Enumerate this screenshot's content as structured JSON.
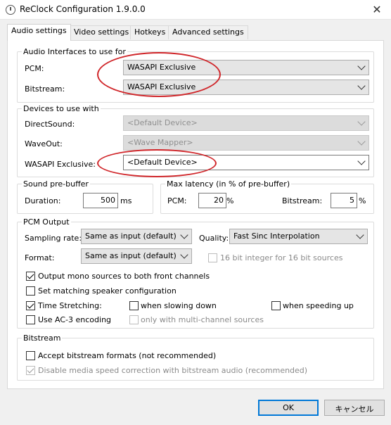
{
  "window": {
    "title": "ReClock Configuration 1.9.0.0"
  },
  "tabs": [
    "Audio settings",
    "Video settings",
    "Hotkeys",
    "Advanced settings"
  ],
  "audio_interfaces": {
    "legend": "Audio Interfaces to use for",
    "pcm_label": "PCM:",
    "pcm_value": "WASAPI Exclusive",
    "bitstream_label": "Bitstream:",
    "bitstream_value": "WASAPI Exclusive"
  },
  "devices": {
    "legend": "Devices to use with",
    "directsound_label": "DirectSound:",
    "directsound_value": "<Default Device>",
    "waveout_label": "WaveOut:",
    "waveout_value": "<Wave Mapper>",
    "wasapi_label": "WASAPI Exclusive:",
    "wasapi_value": "<Default Device>"
  },
  "prebuffer": {
    "legend": "Sound pre-buffer",
    "duration_label": "Duration:",
    "duration_value": "500",
    "unit": "ms"
  },
  "latency": {
    "legend": "Max latency (in % of pre-buffer)",
    "pcm_label": "PCM:",
    "pcm_value": "20",
    "bitstream_label": "Bitstream:",
    "bitstream_value": "5",
    "unit": "%"
  },
  "pcm_output": {
    "legend": "PCM Output",
    "sampling_label": "Sampling rate:",
    "sampling_value": "Same as input (default)",
    "quality_label": "Quality:",
    "quality_value": "Fast Sinc Interpolation",
    "format_label": "Format:",
    "format_value": "Same as input (default)",
    "int16_label": "16 bit integer for 16 bit sources",
    "mono_label": "Output mono sources to both front channels",
    "speaker_label": "Set matching speaker configuration",
    "time_stretch_label": "Time Stretching:",
    "slowing_label": "when slowing down",
    "speeding_label": "when speeding up",
    "ac3_label": "Use AC-3 encoding",
    "multichannel_label": "only with multi-channel sources"
  },
  "bitstream": {
    "legend": "Bitstream",
    "accept_label": "Accept bitstream formats (not recommended)",
    "disable_label": "Disable media speed correction with bitstream audio (recommended)"
  },
  "buttons": {
    "ok": "OK",
    "cancel": "キャンセル"
  },
  "states": {
    "int16_checked": false,
    "mono_checked": true,
    "speaker_checked": false,
    "time_stretch_checked": true,
    "slowing_checked": false,
    "speeding_checked": false,
    "ac3_checked": false,
    "multichannel_checked": false,
    "accept_checked": false,
    "disable_checked": true
  },
  "colors": {
    "annotation_red": "#d0262a",
    "focus_blue": "#0078d7"
  }
}
